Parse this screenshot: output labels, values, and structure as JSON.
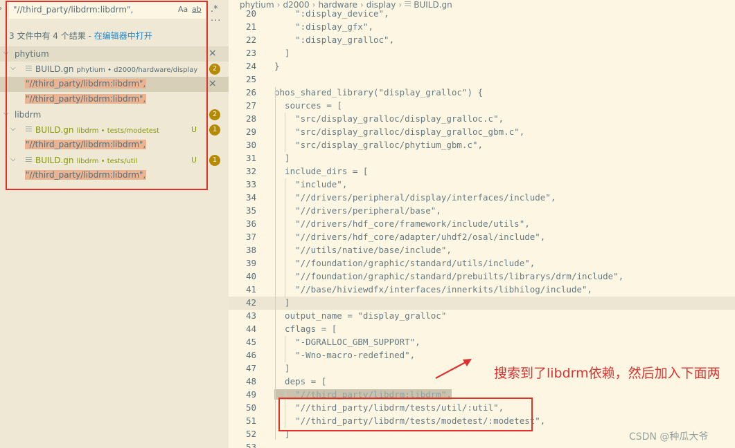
{
  "search": {
    "query": "\"//third_party/libdrm:libdrm\",",
    "opt_case": "Aa",
    "opt_word": "ab",
    "opt_regex": ".*",
    "more": "···",
    "expand_glyph": "›"
  },
  "summary": {
    "prefix": "3 文件中有 4 个结果 - ",
    "link": "在编辑器中打开"
  },
  "results": {
    "folder1": {
      "name": "phytium",
      "close": "×"
    },
    "file1": {
      "name": "BUILD.gn",
      "path": "phytium • d2000/hardware/display",
      "count": "2"
    },
    "file1_matches": [
      "\"//third_party/libdrm:libdrm\",",
      "\"//third_party/libdrm:libdrm\","
    ],
    "folder2": {
      "name": "libdrm",
      "count": "2"
    },
    "file2": {
      "name": "BUILD.gn",
      "path": "libdrm • tests/modetest",
      "status": "U",
      "count": "1"
    },
    "file2_matches": [
      "\"//third_party/libdrm:libdrm\","
    ],
    "file3": {
      "name": "BUILD.gn",
      "path": "libdrm • tests/util",
      "status": "U",
      "count": "1"
    },
    "file3_matches": [
      "\"//third_party/libdrm:libdrm\","
    ]
  },
  "breadcrumb": [
    "phytium",
    "d2000",
    "hardware",
    "display",
    "BUILD.gn"
  ],
  "code": {
    "line_numbers": [
      "20",
      "21",
      "22",
      "23",
      "24",
      "25",
      "26",
      "27",
      "28",
      "29",
      "30",
      "31",
      "32",
      "33",
      "34",
      "35",
      "36",
      "37",
      "38",
      "39",
      "40",
      "41",
      "42",
      "43",
      "44",
      "45",
      "46",
      "47",
      "48",
      "49",
      "50",
      "51",
      "52",
      "53"
    ],
    "lines": [
      "    \":display_device\",",
      "    \":display_gfx\",",
      "    \":display_gralloc\",",
      "  ]",
      "}",
      "",
      "ohos_shared_library(\"display_gralloc\") {",
      "  sources = [",
      "    \"src/display_gralloc/display_gralloc.c\",",
      "    \"src/display_gralloc/display_gralloc_gbm.c\",",
      "    \"src/display_gralloc/phytium_gbm.c\",",
      "  ]",
      "  include_dirs = [",
      "    \"include\",",
      "    \"//drivers/peripheral/display/interfaces/include\",",
      "    \"//drivers/peripheral/base\",",
      "    \"//drivers/hdf_core/framework/include/utils\",",
      "    \"//drivers/hdf_core/adapter/uhdf2/osal/include\",",
      "    \"//utils/native/base/include\",",
      "    \"//foundation/graphic/standard/utils/include\",",
      "    \"//foundation/graphic/standard/prebuilts/librarys/drm/include\",",
      "    \"//base/hiviewdfx/interfaces/innerkits/libhilog/include\",",
      "  ]",
      "  output_name = \"display_gralloc\"",
      "  cflags = [",
      "    \"-DGRALLOC_GBM_SUPPORT\",",
      "    \"-Wno-macro-redefined\",",
      "  ]",
      "  deps = [",
      "    \"//third_party/libdrm:libdrm\",",
      "    \"//third_party/libdrm/tests/util/:util\",",
      "    \"//third_party/libdrm/tests/modetest/:modetest\",",
      "  ]",
      ""
    ]
  },
  "annotation": {
    "text": "搜索到了libdrm依赖，然后加入下面两"
  },
  "watermark": "CSDN @种瓜大爷",
  "colors": {
    "background": "#fdf6e3",
    "sidebar": "#eee8d5",
    "annotation": "#dc322f",
    "badge": "#b58900",
    "link": "#268bd2",
    "untracked": "#859900"
  }
}
